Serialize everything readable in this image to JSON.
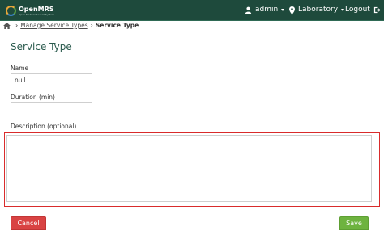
{
  "header": {
    "brand": "OpenMRS",
    "brand_tagline": "Open Medical Record System",
    "user": "admin",
    "location": "Laboratory",
    "logout": "Logout"
  },
  "breadcrumb": {
    "home_icon": "home-icon",
    "link": "Manage Service Types",
    "current": "Service Type"
  },
  "page": {
    "title": "Service Type"
  },
  "form": {
    "name_label": "Name",
    "name_value": "null",
    "duration_label": "Duration (min)",
    "duration_value": "",
    "description_label": "Description (optional)",
    "description_value": ""
  },
  "buttons": {
    "cancel": "Cancel",
    "save": "Save"
  },
  "colors": {
    "header_bg": "#1e4a3c",
    "title": "#2b5b4e",
    "cancel": "#d94343",
    "save": "#6eb33f",
    "highlight": "#d92b2b"
  }
}
